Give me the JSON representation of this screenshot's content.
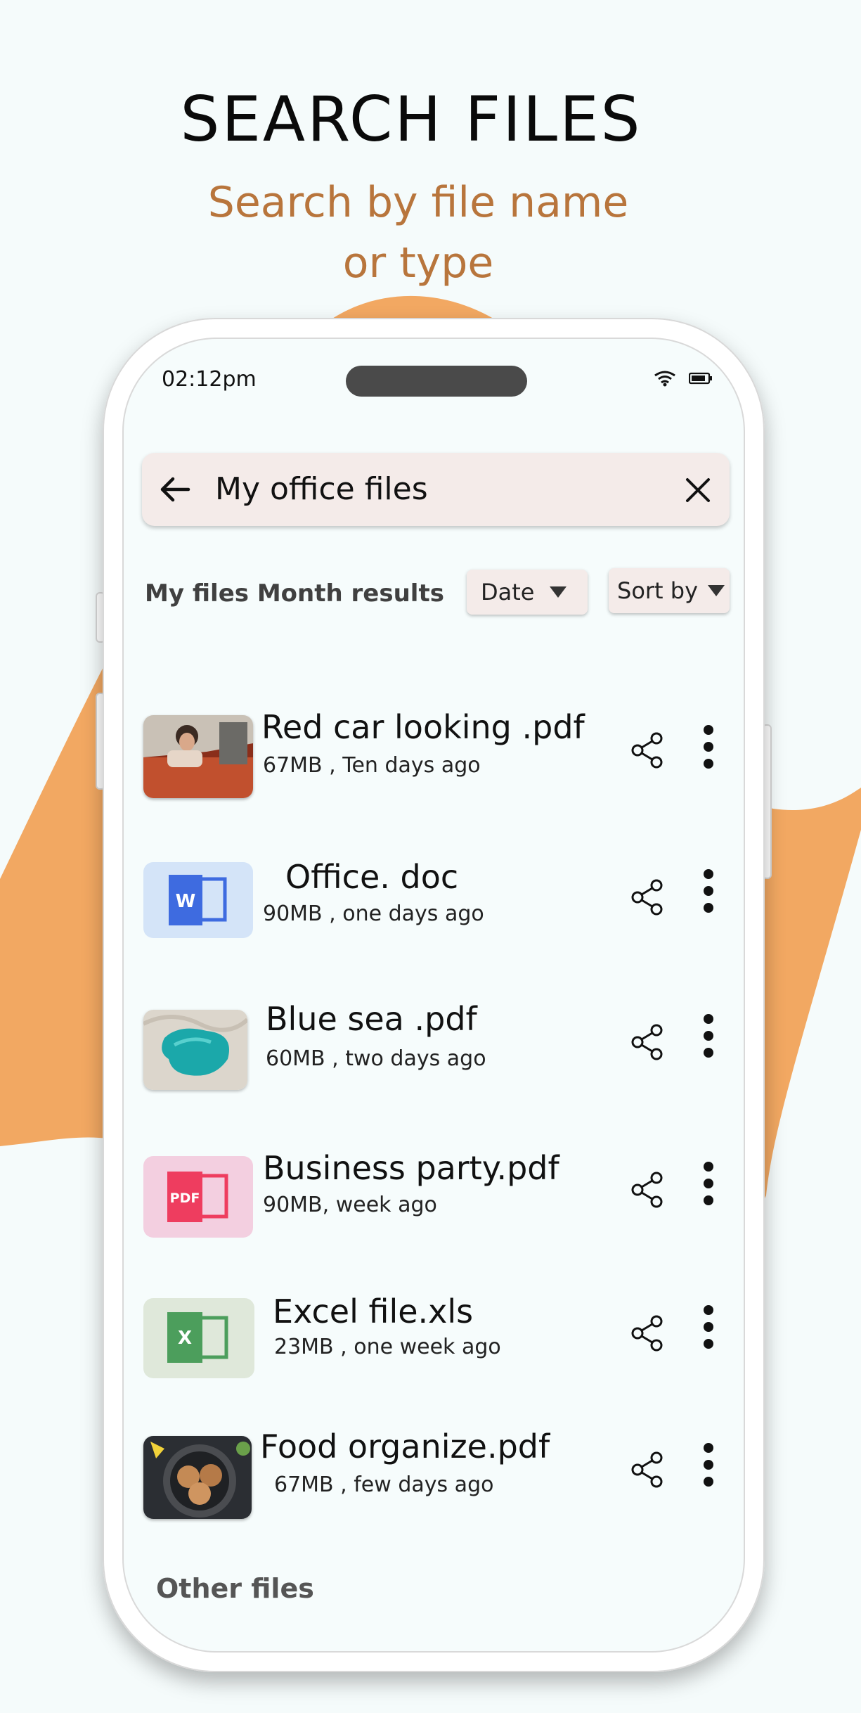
{
  "promo": {
    "title": "SEARCH FILES",
    "subtitle_line1": "Search by file name",
    "subtitle_line2": "or type"
  },
  "colors": {
    "accent_orange": "#f2a862",
    "subtitle_brown": "#b8753c",
    "search_bg": "#f4ebe9",
    "word_blue": "#3e6be0",
    "pdf_red": "#ee3d5f",
    "excel_green": "#4c9e5c"
  },
  "status_bar": {
    "time": "02:12pm",
    "icons": [
      "wifi-icon",
      "battery-icon"
    ]
  },
  "search": {
    "query": "My office files",
    "back_icon": "back-arrow-icon",
    "clear_icon": "close-icon"
  },
  "results": {
    "label": "My files Month results",
    "date_filter": "Date",
    "sort_filter": "Sort by"
  },
  "files": [
    {
      "name": "Red car looking .pdf",
      "meta": "67MB , Ten days ago",
      "thumb": "photo-red-car"
    },
    {
      "name": "Office. doc",
      "meta": "90MB , one days ago",
      "thumb": "word-icon",
      "icon_letter": "W"
    },
    {
      "name": "Blue sea .pdf",
      "meta": "60MB , two days ago",
      "thumb": "photo-blue-sea"
    },
    {
      "name": "Business party.pdf",
      "meta": "90MB, week ago",
      "thumb": "pdf-icon",
      "icon_letter": "PDF"
    },
    {
      "name": "Excel file.xls",
      "meta": "23MB ,  one week ago",
      "thumb": "excel-icon",
      "icon_letter": "X"
    },
    {
      "name": "Food organize.pdf",
      "meta": "67MB , few days ago",
      "thumb": "photo-food"
    }
  ],
  "other_files_label": "Other files"
}
